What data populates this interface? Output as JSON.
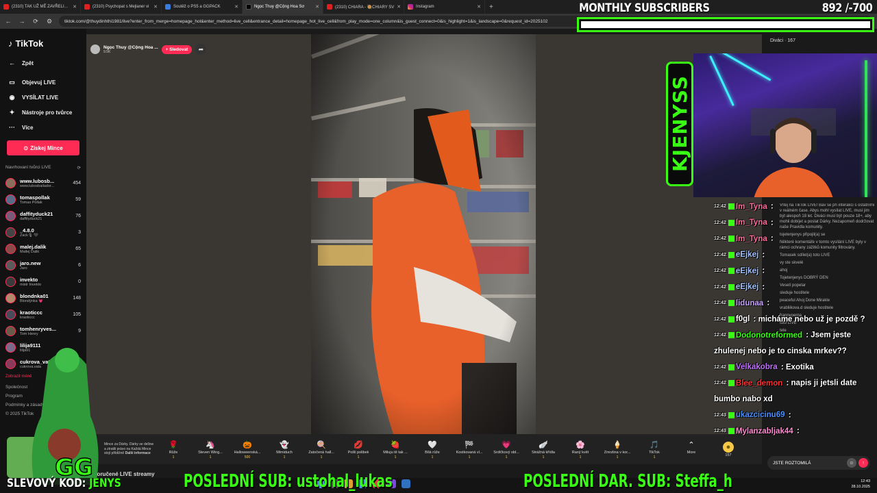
{
  "browser": {
    "tabs": [
      {
        "title": "(2310) TAK UŽ MĚ ZAVŘELI…",
        "icon": "youtube-icon"
      },
      {
        "title": "(2310) Psychopat s Mejlaner vi",
        "icon": "youtube-icon"
      },
      {
        "title": "Soutěž o PS5 a GGPACK",
        "icon": "web-icon"
      },
      {
        "title": "Ngọc Thuy @Cộng Hoa Sơ",
        "icon": "tiktok-icon"
      },
      {
        "title": "(2310) CHIARA - 🥘CHIARY SV",
        "icon": "youtube-icon"
      },
      {
        "title": "Instagram",
        "icon": "instagram-icon"
      }
    ],
    "url": "tiktok.com/@thuydinhthi1981/live?enter_from_merge=homepage_hot&enter_method=live_cell&entrance_detail=homepage_hot_live_cell&from_play_mode=one_column&is_guest_connect=0&is_highlight=1&is_landscape=0&request_id=2025102"
  },
  "sidebar": {
    "logo": "TikTok",
    "back": "Zpět",
    "nav": [
      {
        "label": "Objevuj LIVE",
        "icon": "tv-icon"
      },
      {
        "label": "VYSÍLAT LIVE",
        "icon": "broadcast-icon"
      },
      {
        "label": "Nástroje pro tvůrce",
        "icon": "lightbulb-icon"
      },
      {
        "label": "Více",
        "icon": "more-icon"
      }
    ],
    "coins_button": "Získej Mince",
    "section_title": "Navrhovaní tvůrci LIVE",
    "creators": [
      {
        "name": "www.lubosb...",
        "sub": "www.lubosbailador...",
        "count": "454",
        "color": "#8a6d5a"
      },
      {
        "name": "tomaspollak",
        "sub": "Tomas Pollak",
        "count": "59",
        "color": "#5a6a8a"
      },
      {
        "name": "daffityduck21",
        "sub": "daffityduck21",
        "count": "76",
        "color": "#7a5a7a"
      },
      {
        "name": "_4.8.0",
        "sub": "Zack🎙 🖤",
        "count": "3",
        "color": "#444"
      },
      {
        "name": "malej.dalik",
        "sub": "Mallej Dalik",
        "count": "65",
        "color": "#8a4a4a"
      },
      {
        "name": "jaro.new",
        "sub": "Jaro",
        "count": "6",
        "color": "#5a5a5a"
      },
      {
        "name": "invekto",
        "sub": "mistr Invekto",
        "count": "0",
        "color": "#3a3a3a"
      },
      {
        "name": "blondnka01",
        "sub": "Blondýnka 💗",
        "count": "148",
        "color": "#b08a6a"
      },
      {
        "name": "kraoticcc",
        "sub": "kraoticcc",
        "count": "105",
        "color": "#4a4a5a"
      },
      {
        "name": "tomhenryves...",
        "sub": "Tom Henry",
        "count": "9",
        "color": "#6a5a4a"
      },
      {
        "name": "lilija9111",
        "sub": "lilija91",
        "count": "",
        "color": "#7a6a8a"
      },
      {
        "name": "cukrova_vat...",
        "sub": "cukrova.vata",
        "count": "",
        "color": "#8a3a5a"
      }
    ],
    "show_less": "Zobrazit méně",
    "footer": [
      "Společnost",
      "Program",
      "Podmínky a zásady",
      "© 2025 TikTok"
    ]
  },
  "stream": {
    "host_name": "Ngọc Thuy @Cộng Hoa ...",
    "host_viewers": "9.5K",
    "follow": "+ Sledovat",
    "gift_info": "Mince za Dárky. Dárky se dellow a ztratili právo na Každá Mince stojí přibližně",
    "gift_info_link": "Další informace",
    "gifts": [
      {
        "label": "Růže",
        "price": "1",
        "emoji": "🌹"
      },
      {
        "label": "Steven Wing...",
        "price": "1",
        "emoji": "🦄"
      },
      {
        "label": "Halloweenská...",
        "price": "500",
        "emoji": "🎃"
      },
      {
        "label": "Mimiduch",
        "price": "1",
        "emoji": "👻"
      },
      {
        "label": "Zatočená hall...",
        "price": "1",
        "emoji": "🍭"
      },
      {
        "label": "Pošli polibek",
        "price": "1",
        "emoji": "💋"
      },
      {
        "label": "Miluju tě tak ...",
        "price": "1",
        "emoji": "🍓"
      },
      {
        "label": "Bílá růže",
        "price": "1",
        "emoji": "🤍"
      },
      {
        "label": "Kostkovaná vl...",
        "price": "1",
        "emoji": "🏁"
      },
      {
        "label": "Srdíčkový obl...",
        "price": "1",
        "emoji": "💗"
      },
      {
        "label": "Strážná křídla",
        "price": "1",
        "emoji": "🪽"
      },
      {
        "label": "Raný květ",
        "price": "1",
        "emoji": "🌸"
      },
      {
        "label": "Zmrzlina v kor...",
        "price": "1",
        "emoji": "🍦"
      },
      {
        "label": "TikTok",
        "price": "1",
        "emoji": "🎵"
      },
      {
        "label": "More",
        "price": "",
        "emoji": "⌃"
      }
    ],
    "coin_balance": "157",
    "recommended": "Doporučené LIVE streamy"
  },
  "right_panel": {
    "viewers": "Diváci · 167",
    "chat_input": "JSTE ROZTOMILÁ",
    "tiktok_chat_lines": [
      "Vítej na TikTok LIVE! Bav se při interakci s ostatními v reálném čase. Abys mohl vysílat LIVE, musí jim být alespoň 18 let. Diváci musí být pouze 18+, aby mohli dobíjet a poslat Dárky. Nezapomeň dodržovat naše Pravidla komunity.",
      "tojetenjenys připojil(a) se",
      "Některé komentáře v tomto vysílání LIVE byly v rámci ochrany zážitků komunity filtrovány.",
      "Tomasek sdílel(a) toto LIVE",
      "vy ste skvelé",
      "ahoj",
      "Tojetenjenys DOBRÝ DEN",
      "Veselí popelar",
      "sleduje hostitele",
      "peaceful Ahoj Done Mirakle",
      "vrabliikova.d sleduje hostitele",
      "frannyoerna",
      "toto LIVE",
      "tele"
    ]
  },
  "overlay": {
    "monthly_title": "MONTHLY SUBSCRIBERS",
    "monthly_count": "892",
    "monthly_goal": "/-700",
    "monthly_progress": 1.0,
    "logo_text": "KJENYSS",
    "chat": [
      {
        "time": "12:42",
        "user": "Im_Tyna",
        "color": "#ff6b9d",
        "msg": ""
      },
      {
        "time": "12:42",
        "user": "Im_Tyna",
        "color": "#ff6b9d",
        "msg": ""
      },
      {
        "time": "12:42",
        "user": "Im_Tyna",
        "color": "#ff6b9d",
        "msg": ""
      },
      {
        "time": "12:42",
        "user": "eEjkej",
        "color": "#a0c4ff",
        "msg": ""
      },
      {
        "time": "12:42",
        "user": "eEjkej",
        "color": "#a0c4ff",
        "msg": ""
      },
      {
        "time": "12:42",
        "user": "eEjkej",
        "color": "#a0c4ff",
        "msg": ""
      },
      {
        "time": "12:42",
        "user": "lidunaa",
        "color": "#c8a2ff",
        "msg": ""
      },
      {
        "time": "12:42",
        "user": "f0gl",
        "color": "#ffffff",
        "msg": "micháme nebo už je pozdě ?"
      },
      {
        "time": "12:42",
        "user": "Dodonotreformed",
        "color": "#39ff14",
        "msg": "Jsem jeste zhulenej nebo je to cinska mrkev??"
      },
      {
        "time": "12:42",
        "user": "Velkakobra",
        "color": "#c070ff",
        "msg": "Exotika"
      },
      {
        "time": "12:42",
        "user": "Blee_demon",
        "color": "#ff3030",
        "msg": "napis ji jetsli date bumbo nabo xd"
      },
      {
        "time": "12:43",
        "user": "ukazcicinu69",
        "color": "#4a90ff",
        "msg": ""
      },
      {
        "time": "12:43",
        "user": "Mylanzabljak44",
        "color": "#ff8ad0",
        "msg": ""
      }
    ],
    "discount_label": "SLEVOVÝ KOD:",
    "discount_code": "JENYS",
    "last_sub": "POSLEDNÍ SUB: ustohal_lukas",
    "last_gift_sub": "POSLEDNÍ DAR. SUB: Steffa_h"
  },
  "taskbar": {
    "time": "12:43",
    "date": "28.10.2025"
  }
}
